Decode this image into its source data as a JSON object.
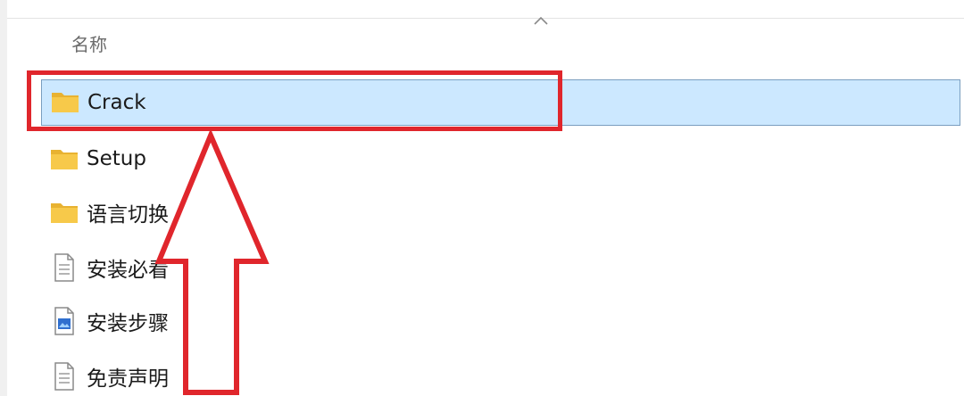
{
  "columns": {
    "name": "名称"
  },
  "files": [
    {
      "name": "Crack",
      "icon": "folder-icon",
      "selected": true
    },
    {
      "name": "Setup",
      "icon": "folder-icon",
      "selected": false
    },
    {
      "name": "语言切换",
      "icon": "folder-icon",
      "selected": false
    },
    {
      "name": "安装必看",
      "icon": "text-file-icon",
      "selected": false
    },
    {
      "name": "安装步骤",
      "icon": "image-file-icon",
      "selected": false
    },
    {
      "name": "免责声明",
      "icon": "text-file-icon",
      "selected": false
    }
  ],
  "colors": {
    "selection_bg": "#cce8ff",
    "selection_border": "#7a9ebf",
    "annotation": "#e0262c",
    "folder": "#f7c94a"
  }
}
